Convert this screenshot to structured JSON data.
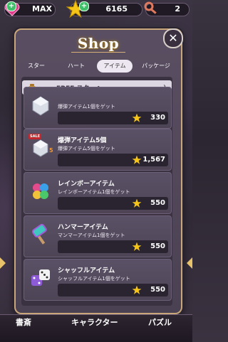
{
  "status": {
    "lives": "MAX",
    "stars": "6165",
    "keys": "2"
  },
  "shop": {
    "title": "Shop",
    "tabs": [
      {
        "label": "スター"
      },
      {
        "label": "ハート"
      },
      {
        "label": "アイテム"
      },
      {
        "label": "パッケージ"
      }
    ],
    "free_star_banner": "FREE スターへ",
    "items": [
      {
        "name": "",
        "desc": "爆弾アイテム1個をゲット",
        "price": "330",
        "icon": "bomb-icon"
      },
      {
        "name": "爆弾アイテム5個",
        "desc": "爆弾アイテム5個をゲット",
        "price": "1,567",
        "badge": "SALE",
        "qty": "5",
        "icon": "bomb-icon"
      },
      {
        "name": "レインボーアイテム",
        "desc": "レインボーアイテム1個をゲット",
        "price": "550",
        "icon": "rainbow-clover-icon"
      },
      {
        "name": "ハンマーアイテム",
        "desc": "マンマーアイテム1個をゲット",
        "price": "550",
        "icon": "hammer-icon"
      },
      {
        "name": "シャッフルアイテム",
        "desc": "シャッフルアイテム1個をゲット",
        "price": "550",
        "icon": "dice-icon"
      }
    ]
  },
  "bottom_nav": [
    {
      "label": "書斎"
    },
    {
      "label": "キャラクター"
    },
    {
      "label": "パズル"
    }
  ],
  "colors": {
    "accent_gold": "#c9a77a",
    "price_star": "#f5c518",
    "sale_red": "#c0282d"
  }
}
